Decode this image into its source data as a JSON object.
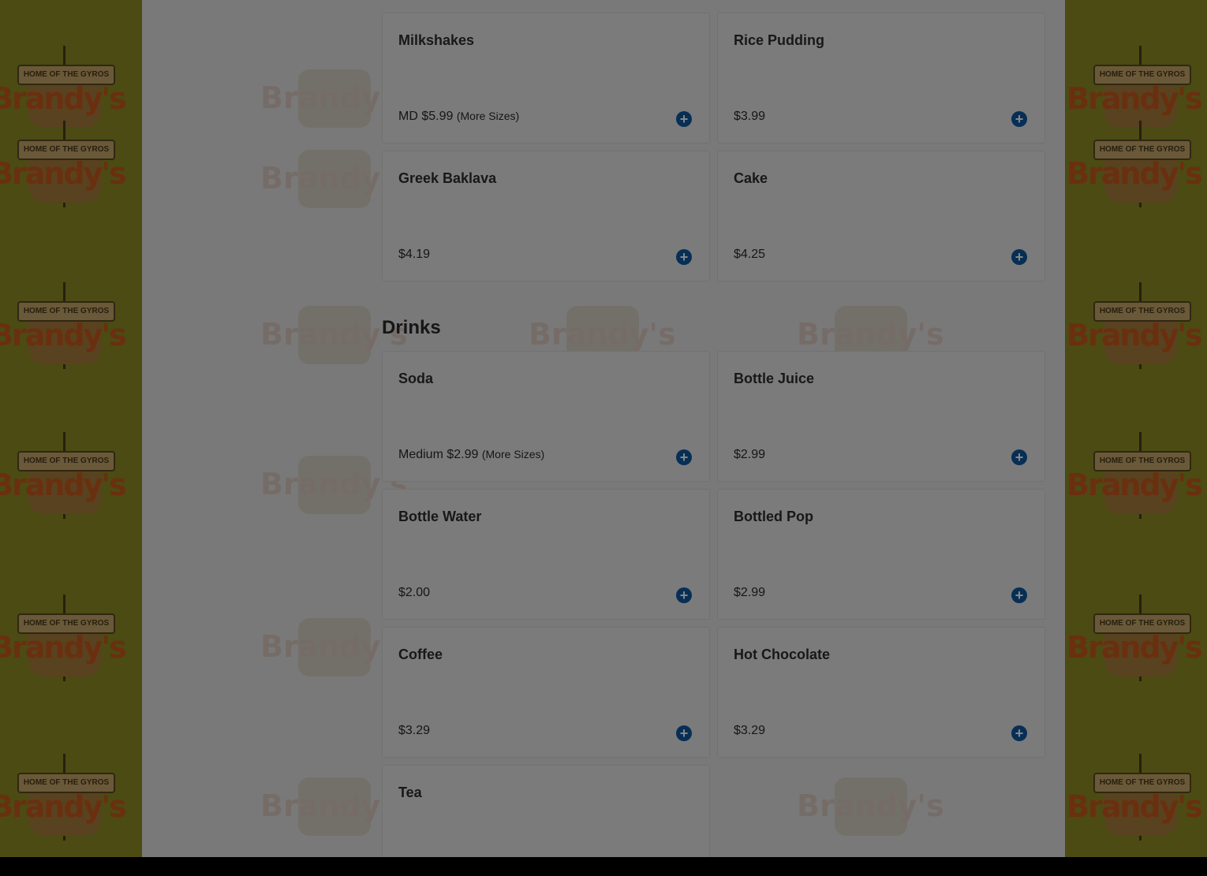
{
  "branding": {
    "logo_tagline": "HOME OF THE GYROS",
    "logo_name": "Brandy's"
  },
  "menu": {
    "desserts_items": [
      {
        "name": "Milkshakes",
        "price": "MD $5.99",
        "more": "(More Sizes)"
      },
      {
        "name": "Rice Pudding",
        "price": "$3.99",
        "more": ""
      },
      {
        "name": "Greek Baklava",
        "price": "$4.19",
        "more": ""
      },
      {
        "name": "Cake",
        "price": "$4.25",
        "more": ""
      }
    ],
    "drinks": {
      "title": "Drinks",
      "items": [
        {
          "name": "Soda",
          "price": "Medium $2.99",
          "more": "(More Sizes)"
        },
        {
          "name": "Bottle Juice",
          "price": "$2.99",
          "more": ""
        },
        {
          "name": "Bottle Water",
          "price": "$2.00",
          "more": ""
        },
        {
          "name": "Bottled Pop",
          "price": "$2.99",
          "more": ""
        },
        {
          "name": "Coffee",
          "price": "$3.29",
          "more": ""
        },
        {
          "name": "Hot Chocolate",
          "price": "$3.29",
          "more": ""
        },
        {
          "name": "Tea",
          "price": "",
          "more": ""
        }
      ]
    }
  },
  "colors": {
    "accent": "#0f5aa0",
    "side_background": "#c8c83a",
    "logo_text": "#e0662a"
  },
  "icons": {
    "add": "plus-circle-icon"
  }
}
